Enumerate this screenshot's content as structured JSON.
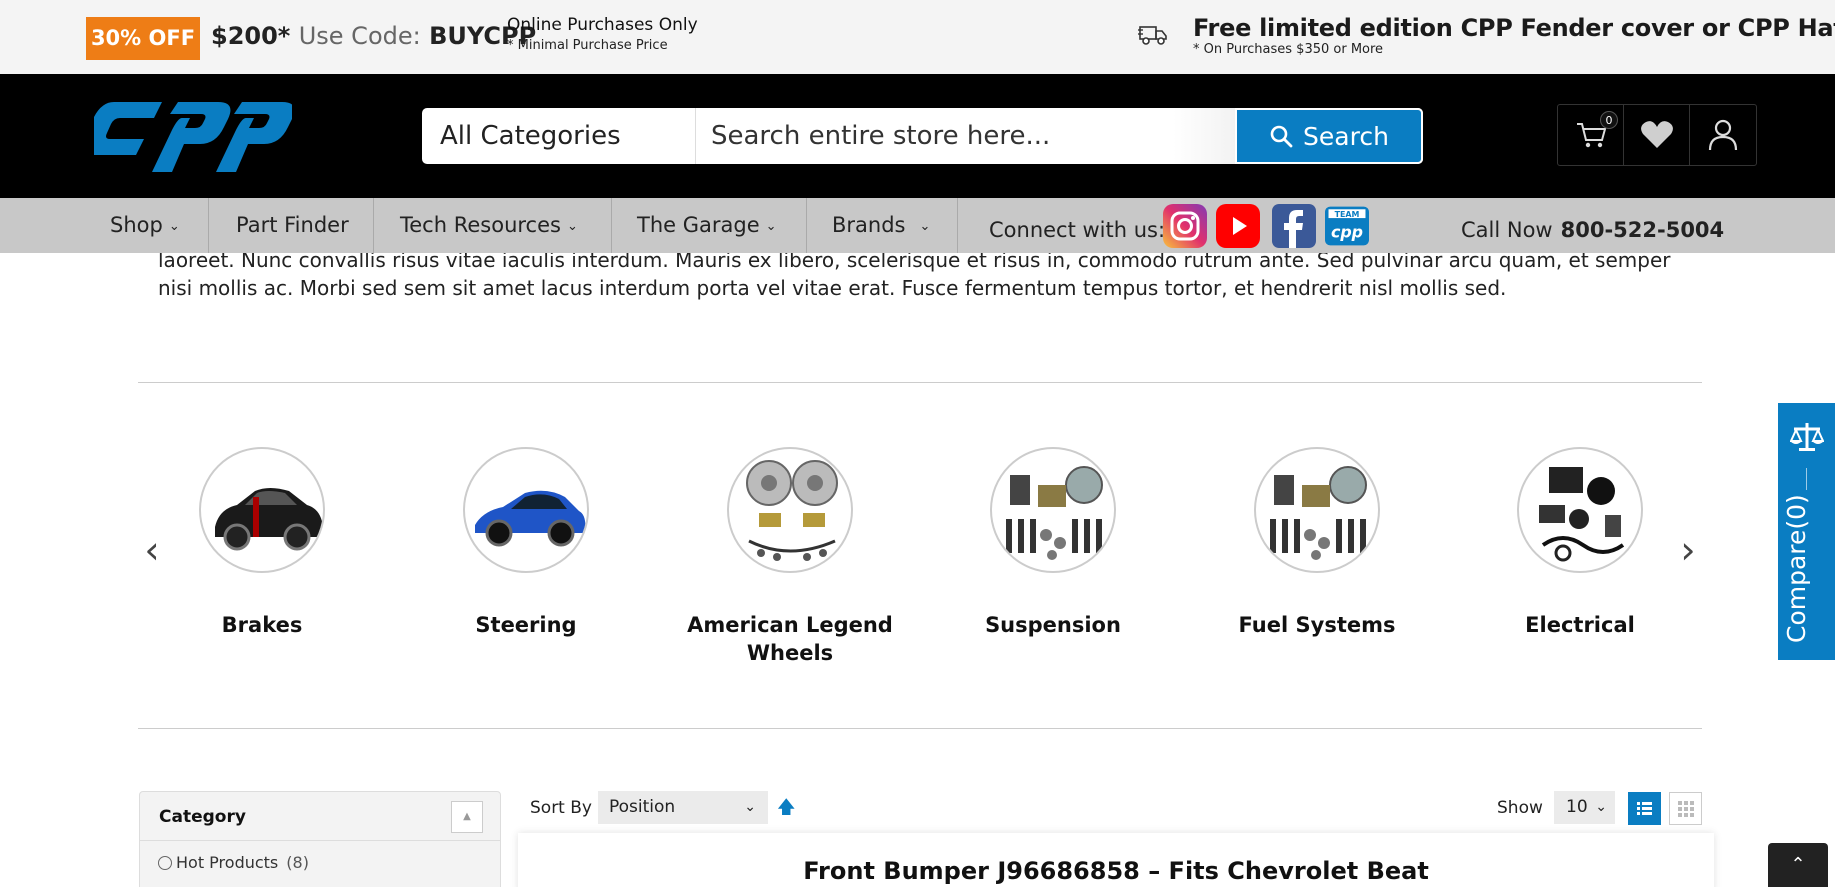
{
  "promo": {
    "badge": "30% OFF",
    "amount": "$200*",
    "use_code": "Use Code:",
    "code": "BUYCPP",
    "online_only": "Online Purchases Only",
    "min_price": "* Minimal Purchase Price",
    "free_offer": "Free limited edition CPP Fender cover or CPP Hat",
    "free_condition": "* On Purchases $350 or More"
  },
  "header": {
    "category_select": "All Categories",
    "search_placeholder": "Search entire store here...",
    "search_button": "Search",
    "cart_count": "0"
  },
  "nav": {
    "items": [
      {
        "label": "Shop",
        "has_dropdown": true
      },
      {
        "label": "Part Finder",
        "has_dropdown": false
      },
      {
        "label": "Tech Resources",
        "has_dropdown": true
      },
      {
        "label": "The Garage",
        "has_dropdown": true
      },
      {
        "label": "Brands",
        "has_dropdown": true
      }
    ],
    "connect_label": "Connect with us:",
    "social": [
      "instagram-icon",
      "youtube-icon",
      "facebook-icon",
      "team-cpp-icon"
    ],
    "call_label": "Call Now",
    "phone": "800-522-5004"
  },
  "intro_text": "laoreet. Nunc convallis risus vitae iaculis interdum. Mauris ex libero, scelerisque et risus in, commodo rutrum ante. Sed pulvinar arcu quam, et semper nisi mollis ac. Morbi sed sem sit amet lacus interdum porta vel vitae erat. Fusce fermentum tempus tortor, et hendrerit nisl mollis sed.",
  "categories": [
    {
      "name": "Brakes",
      "image": "black-camaro"
    },
    {
      "name": "Steering",
      "image": "blue-jaguar"
    },
    {
      "name": "American Legend Wheels",
      "image": "brake-kit"
    },
    {
      "name": "Suspension",
      "image": "suspension-kit"
    },
    {
      "name": "Fuel Systems",
      "image": "suspension-kit"
    },
    {
      "name": "Electrical",
      "image": "electrical-parts"
    }
  ],
  "compare": {
    "label": "Compare(0)"
  },
  "sidebar": {
    "title": "Category",
    "options": [
      {
        "label": "Hot Products",
        "count": "(8)"
      }
    ]
  },
  "toolbar": {
    "sort_by_label": "Sort By",
    "sort_value": "Position",
    "show_label": "Show",
    "show_value": "10"
  },
  "product": {
    "title": "Front Bumper J96686858 – Fits Chevrolet Beat"
  },
  "colors": {
    "accent": "#0a7dc2",
    "promo_orange": "#ee7d16",
    "nav_bg": "#c8c8c8"
  }
}
